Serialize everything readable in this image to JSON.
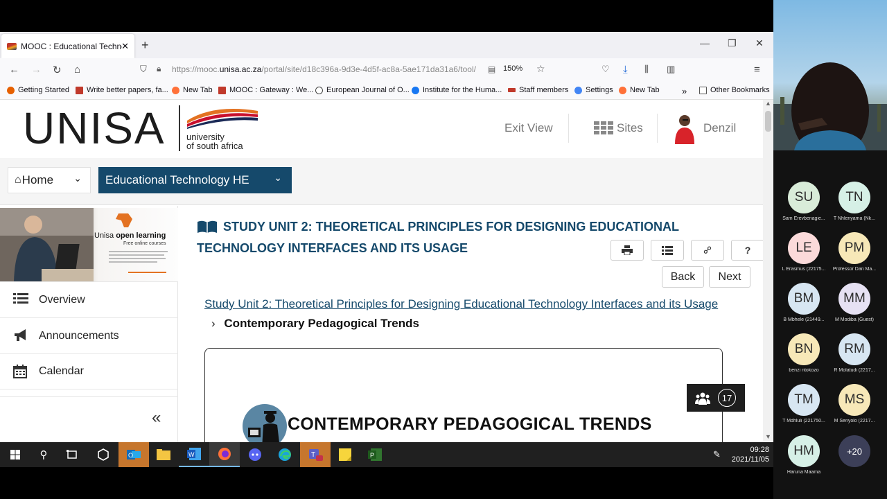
{
  "browser": {
    "tab_title": "MOOC : Educational Technolog",
    "url_prefix": "https://mooc.",
    "url_domain": "unisa.ac.za",
    "url_rest": "/portal/site/d18c396a-9d3e-4d5f-ac8a-5ae171da31a6/tool/",
    "zoom": "150%",
    "bookmarks": [
      "Getting Started",
      "Write better papers, fa...",
      "New Tab",
      "MOOC : Gateway : We...",
      "European Journal of O...",
      "Institute for the Huma...",
      "Staff members",
      "Settings",
      "New Tab"
    ],
    "other_bookmarks": "Other Bookmarks"
  },
  "header": {
    "logo_text": "UNISA",
    "logo_sub1": "university",
    "logo_sub2": "of south africa",
    "exit_view": "Exit View",
    "sites": "Sites",
    "user": "Denzil"
  },
  "menu": {
    "home": "Home",
    "site": "Educational Technology HE"
  },
  "banner": {
    "title_a": "Unisa ",
    "title_b": "open learning",
    "subtitle": "Free online courses"
  },
  "sidebar": {
    "items": [
      "Overview",
      "Announcements",
      "Calendar"
    ],
    "collapse": "«"
  },
  "content": {
    "title": "STUDY UNIT 2: THEORETICAL PRINCIPLES FOR DESIGNING EDUCATIONAL TECHNOLOGY INTERFACES AND ITS USAGE",
    "back": "Back",
    "next": "Next",
    "help": "?",
    "crumb_link": "Study Unit 2: Theoretical Principles for Designing Educational Technology Interfaces and its Usage",
    "crumb_current": "Contemporary Pedagogical Trends",
    "frame_title": "CONTEMPORARY PEDAGOGICAL TRENDS",
    "participants": "17"
  },
  "taskbar": {
    "time": "09:28",
    "date": "2021/11/05"
  },
  "meeting": {
    "participants": [
      {
        "initials": "SU",
        "name": "Sam Erevbenagie...",
        "color": "#d9ecd9"
      },
      {
        "initials": "TN",
        "name": "T Nhlenyama (Nk...",
        "color": "#d6f0e6"
      },
      {
        "initials": "LE",
        "name": "L Erasmus (22175...",
        "color": "#fbdada"
      },
      {
        "initials": "PM",
        "name": "Professor Dan Ma...",
        "color": "#f7e8b8"
      },
      {
        "initials": "BM",
        "name": "B Mbhele (21449...",
        "color": "#d7e6f2"
      },
      {
        "initials": "MM",
        "name": "M Modiba (Guest)",
        "color": "#e6e1f3"
      },
      {
        "initials": "BN",
        "name": "benzi ntokozo",
        "color": "#f7e8b8"
      },
      {
        "initials": "RM",
        "name": "R Molatudi (2217...",
        "color": "#d7e6f2"
      },
      {
        "initials": "TM",
        "name": "T Mdhluli (221750...",
        "color": "#d7e6f2"
      },
      {
        "initials": "MS",
        "name": "M Senyolo (2217...",
        "color": "#f7e8b8"
      },
      {
        "initials": "HM",
        "name": "Haruna Maama",
        "color": "#d6f0e6"
      }
    ],
    "more": "+20"
  }
}
